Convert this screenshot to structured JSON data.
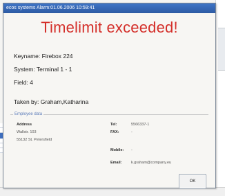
{
  "dialog": {
    "title": "ecos systems Alarm:01.06.2006 10:59:41",
    "headline": "Timelimit exceeded!",
    "headline_color": "#d42f2a",
    "keyname": "Keyname: Firebox 224",
    "system": "System: Terminal 1 - 1",
    "field": "Field: 4",
    "taken_by": "Taken by: Graham,Katharina"
  },
  "employee": {
    "group_title": "Employee data",
    "address_label": "Address",
    "address_line1": "Wallstr. 103",
    "address_line2": "55132  St. Petersfield",
    "tel_label": "Tel:",
    "tel_value": "5566337-1",
    "fax_label": "FAX:",
    "fax_value": "-",
    "mobile_label": "Mobile:",
    "mobile_value": "-",
    "email_label": "Email:",
    "email_value": "k.graham@company.eu"
  },
  "buttons": {
    "ok_label": "OK"
  }
}
